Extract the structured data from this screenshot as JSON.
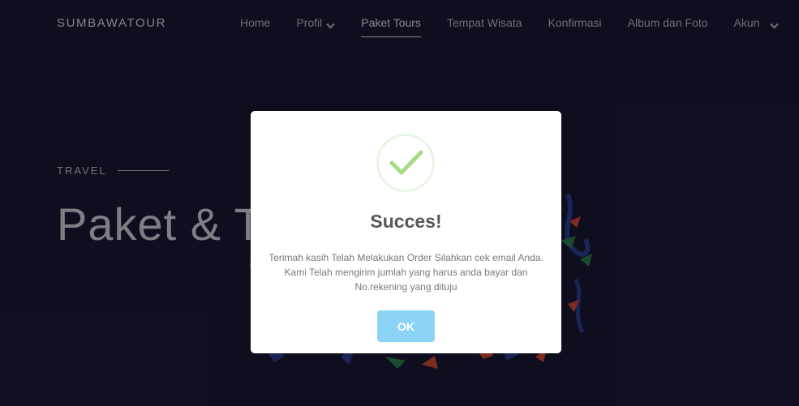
{
  "navbar": {
    "brand": "SUMBAWATOUR",
    "items": [
      {
        "label": "Home"
      },
      {
        "label": "Profil"
      },
      {
        "label": "Paket Tours"
      },
      {
        "label": "Tempat Wisata"
      },
      {
        "label": "Konfirmasi"
      },
      {
        "label": "Album dan Foto"
      },
      {
        "label": "Akun"
      }
    ]
  },
  "hero": {
    "kicker": "TRAVEL",
    "title": "Paket & T"
  },
  "modal": {
    "icon": "success-check-icon",
    "title": "Succes!",
    "message": "Terimah kasih Telah Melakukan Order Silahkan cek email Anda. Kami Telah mengirim jumlah yang harus anda bayar dan No.rekening yang dituju",
    "ok_label": "OK"
  },
  "colors": {
    "background": "#121026",
    "accent_button": "#8cd4f5",
    "check": "#a5dc86"
  }
}
